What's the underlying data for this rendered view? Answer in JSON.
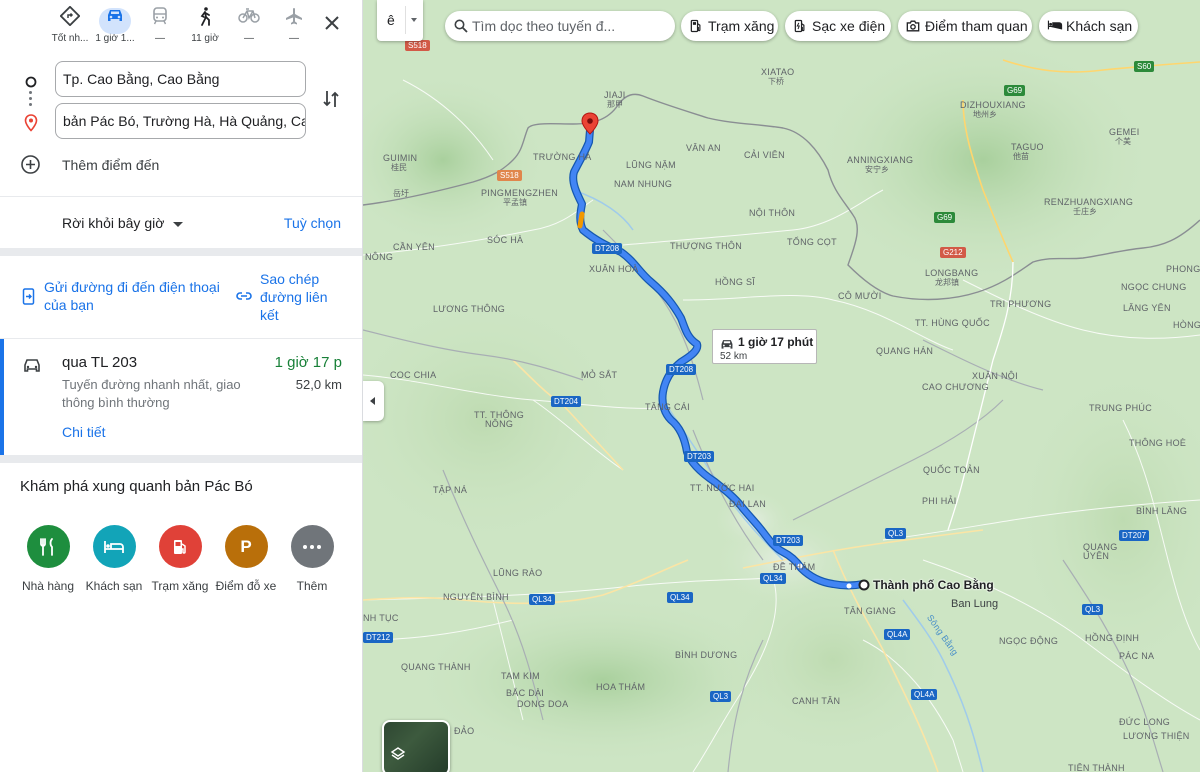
{
  "travel_modes": [
    {
      "name": "best",
      "label": "Tốt nh..."
    },
    {
      "name": "car",
      "label": "1 giờ 1..."
    },
    {
      "name": "transit",
      "label": "—"
    },
    {
      "name": "walk",
      "label": "11 giờ"
    },
    {
      "name": "bike",
      "label": "—"
    },
    {
      "name": "flight",
      "label": "—"
    }
  ],
  "origin": "Tp. Cao Bằng, Cao Bằng",
  "destination": "bản Pác Bó, Trường Hà, Hà Quảng, Cao B",
  "add_destination": "Thêm điểm đến",
  "depart_label": "Rời khỏi bây giờ",
  "options_label": "Tuỳ chọn",
  "send_to_phone": "Gửi đường đi đến điện thoại của bạn",
  "copy_link": "Sao chép đường liên kết",
  "route": {
    "via": "qua TL 203",
    "time": "1 giờ 17 p",
    "distance": "52,0 km",
    "description": "Tuyến đường nhanh nhất, giao thông bình thường",
    "details_link": "Chi tiết"
  },
  "explore": {
    "title": "Khám phá xung quanh bản Pác Bó",
    "items": [
      {
        "label": "Nhà hàng",
        "color": "#1e8e3e"
      },
      {
        "label": "Khách sạn",
        "color": "#12a4b8"
      },
      {
        "label": "Trạm xăng",
        "color": "#e04138"
      },
      {
        "label": "Điểm đỗ xe",
        "color": "#b96f0a"
      },
      {
        "label": "Thêm",
        "color": "#70757a"
      }
    ]
  },
  "map": {
    "language_button": "ê",
    "search_placeholder": "Tìm dọc theo tuyến đ...",
    "chips": [
      "Trạm xăng",
      "Sạc xe điện",
      "Điểm tham quan",
      "Khách sạn"
    ],
    "route_tooltip": {
      "time": "1 giờ 17 phút",
      "distance": "52 km"
    },
    "destination_label": "Thành phố Cao Bằng",
    "destination_sub": "Ban Lung",
    "route_color": "#1a73e8",
    "place_labels": [
      {
        "t": "XIATAO"
      },
      {
        "t": "JIAJI"
      },
      {
        "t": "DIZHOUXIANG"
      },
      {
        "t": "TAGUO"
      },
      {
        "t": "GEMEI"
      },
      {
        "t": "GUIMIN"
      },
      {
        "t": "TRƯỜNG HÀ"
      },
      {
        "t": "LŨNG NẶM"
      },
      {
        "t": "VÂN AN"
      },
      {
        "t": "CẢI VIÊN"
      },
      {
        "t": "ANNINGXIANG"
      },
      {
        "t": "PINGMENGZHEN"
      },
      {
        "t": "NAM NHUNG"
      },
      {
        "t": "RENZHUANGXIANG"
      },
      {
        "t": "NỘI THÔN"
      },
      {
        "t": "CẦN YÊN"
      },
      {
        "t": "SÓC HÀ"
      },
      {
        "t": "THƯỢNG THÔN"
      },
      {
        "t": "TỔNG CỌT"
      },
      {
        "t": "NÔNG"
      },
      {
        "t": "XUÂN HOÀ"
      },
      {
        "t": "LONGBANG"
      },
      {
        "t": "PHONG"
      },
      {
        "t": "HỒNG SĨ"
      },
      {
        "t": "NGỌC CHUNG"
      },
      {
        "t": "CÔ MƯỜI"
      },
      {
        "t": "TRI PHƯƠNG"
      },
      {
        "t": "LĂNG YÊN"
      },
      {
        "t": "LƯƠNG THÔNG"
      },
      {
        "t": "TT. HÙNG QUỐC"
      },
      {
        "t": "QUANG HÁN"
      },
      {
        "t": "COC CHIA"
      },
      {
        "t": "MỎ SẮT"
      },
      {
        "t": "XUÂN NỘI"
      },
      {
        "t": "CAO CHƯƠNG"
      },
      {
        "t": "TT. THÔNG"
      },
      {
        "t": "NÔNG"
      },
      {
        "t": "TĂNG CÁI"
      },
      {
        "t": "TRUNG PHÚC"
      },
      {
        "t": "THÔNG HOÈ"
      },
      {
        "t": "QUỐC TOẢN"
      },
      {
        "t": "TẬP NÁ"
      },
      {
        "t": "TT. NƯỚC HAI"
      },
      {
        "t": "ĐẠI LAN"
      },
      {
        "t": "PHI HẢI"
      },
      {
        "t": "BÌNH LĂNG"
      },
      {
        "t": "LŨNG RÀO"
      },
      {
        "t": "ĐỀ THÁM"
      },
      {
        "t": "QUANG"
      },
      {
        "t": "UYÊN"
      },
      {
        "t": "NGUYÊN BÌNH"
      },
      {
        "t": "TÂN GIANG"
      },
      {
        "t": "NGỌC ĐỘNG"
      },
      {
        "t": "HỒNG ĐỊNH"
      },
      {
        "t": "PÁC NA"
      },
      {
        "t": "QUANG THÀNH"
      },
      {
        "t": "BÌNH DƯƠNG"
      },
      {
        "t": "TAM KIM"
      },
      {
        "t": "HOA THÁM"
      },
      {
        "t": "BẮC DÀI"
      },
      {
        "t": "DONG DOA"
      },
      {
        "t": "CANH TÂN"
      },
      {
        "t": "ĐỨC LONG"
      },
      {
        "t": "LƯƠNG THIỆN"
      },
      {
        "t": "ĐẢO"
      },
      {
        "t": "TIÊN THÀNH"
      },
      {
        "t": "NH TỤC"
      },
      {
        "t": "HÒNG CHÍ"
      }
    ],
    "cjk_labels": [
      "岳圩",
      "那甲",
      "下桥",
      "地州乡",
      "他苗",
      "个美",
      "桂民",
      "平孟镇",
      "安宁乡",
      "龙邦镇",
      "壬庄乡"
    ],
    "road_shields": [
      "S518",
      "S518",
      "G69",
      "S60",
      "G69",
      "G212",
      "DT208",
      "DT208",
      "DT204",
      "DT203",
      "DT203",
      "QL3",
      "DT207",
      "QL34",
      "QL34",
      "QL34",
      "QL4A",
      "QL4A",
      "QL3",
      "QL3",
      "DT212"
    ],
    "river_label": "Sông Bằng"
  }
}
